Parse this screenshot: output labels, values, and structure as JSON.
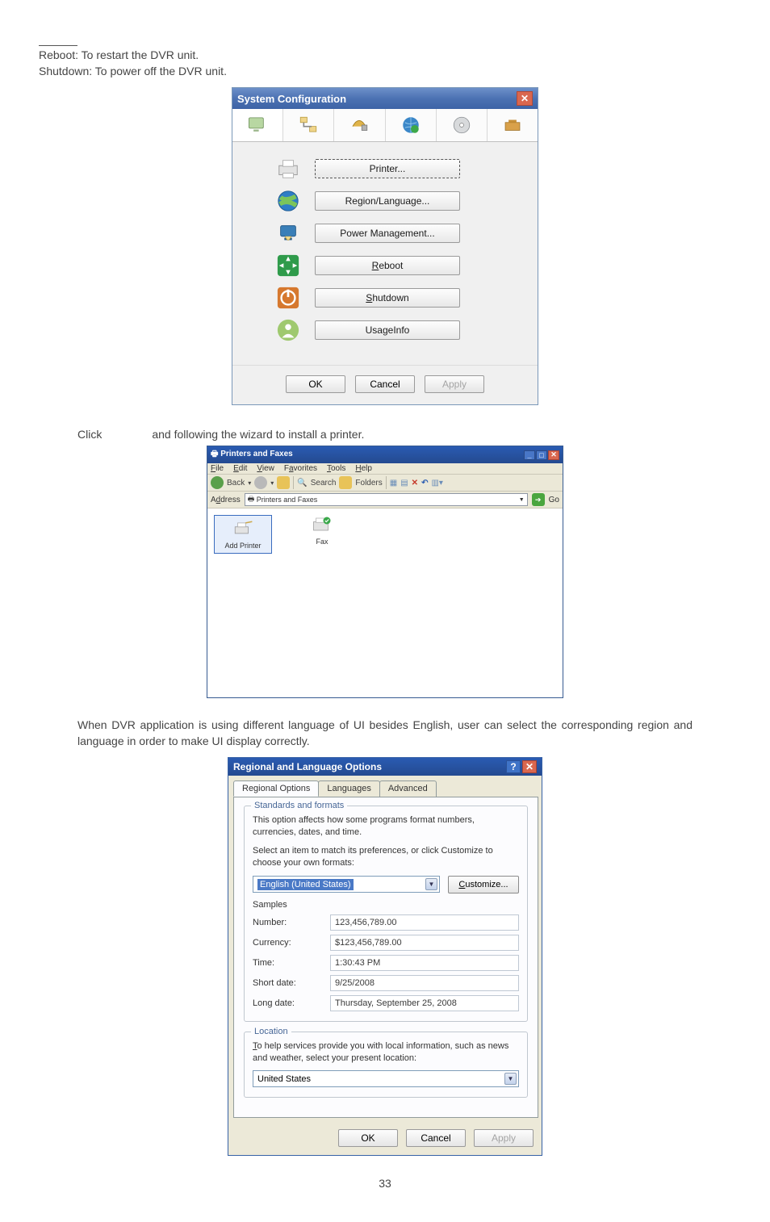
{
  "intro": {
    "line1": "Reboot: To restart the DVR unit.",
    "line2": "Shutdown: To power off the DVR unit."
  },
  "sysconf": {
    "title": "System Configuration",
    "buttons": {
      "printer": "Printer...",
      "region": "Region/Language...",
      "power": "Power Management...",
      "reboot_pre": "",
      "reboot_ul": "R",
      "reboot_post": "eboot",
      "shutdown_pre": "",
      "shutdown_ul": "S",
      "shutdown_post": "hutdown",
      "usage": "UsageInfo"
    },
    "ok": "OK",
    "cancel": "Cancel",
    "apply": "Apply"
  },
  "click_line": {
    "left": "Click",
    "right": "and following the wizard to install a printer."
  },
  "explorer": {
    "title": "Printers and Faxes",
    "menu": {
      "file": "File",
      "edit": "Edit",
      "view": "View",
      "favorites": "Favorites",
      "tools": "Tools",
      "help": "Help"
    },
    "toolbar": {
      "back": "Back",
      "search": "Search",
      "folders": "Folders"
    },
    "addresslabel": "Address",
    "address": "Printers and Faxes",
    "go": "Go",
    "item1": "Add Printer",
    "item2": "Fax"
  },
  "para": "When DVR application is using different language of UI besides English, user can select the corresponding region and language in order to make UI display correctly.",
  "regional": {
    "title": "Regional and Language Options",
    "tabs": {
      "regional": "Regional Options",
      "languages": "Languages",
      "advanced": "Advanced"
    },
    "standards": {
      "legend": "Standards and formats",
      "p1": "This option affects how some programs format numbers, currencies, dates, and time.",
      "p2": "Select an item to match its preferences, or click Customize to choose your own formats:",
      "locale": "English (United States)",
      "customize_pre": "",
      "customize_ul": "C",
      "customize_post": "ustomize...",
      "samples_label": "Samples",
      "labels": {
        "number": "Number:",
        "currency": "Currency:",
        "time": "Time:",
        "shortdate": "Short date:",
        "longdate": "Long date:"
      },
      "values": {
        "number": "123,456,789.00",
        "currency": "$123,456,789.00",
        "time": "1:30:43 PM",
        "shortdate": "9/25/2008",
        "longdate": "Thursday, September 25, 2008"
      }
    },
    "location": {
      "legend": "Location",
      "p_pre": "",
      "p_ul": "T",
      "p_post": "o help services provide you with local information, such as news and weather, select your present location:",
      "value": "United States"
    },
    "ok": "OK",
    "cancel": "Cancel",
    "apply": "Apply"
  },
  "pageno": "33"
}
